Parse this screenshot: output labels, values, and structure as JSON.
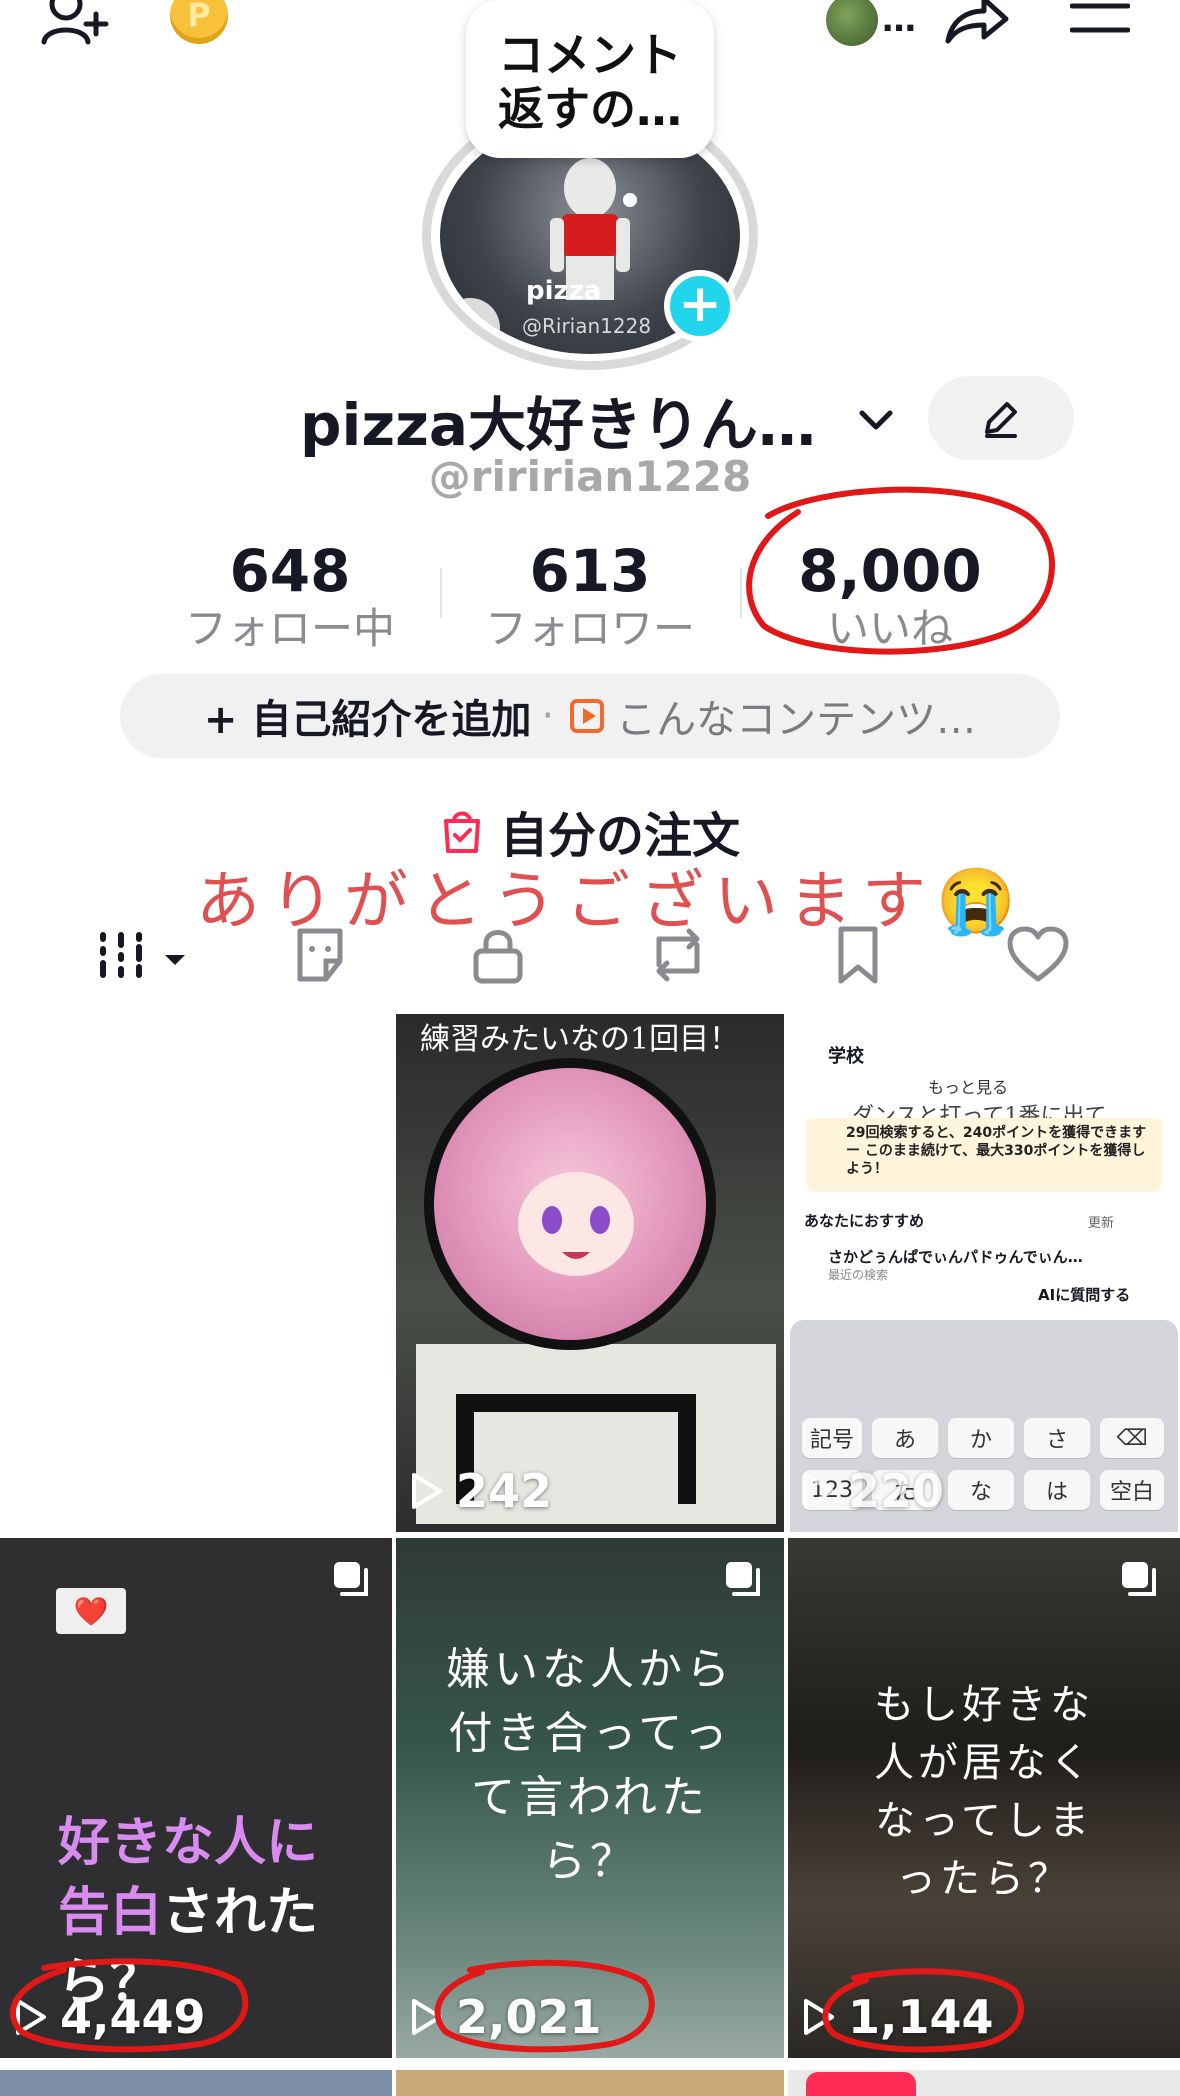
{
  "header": {
    "add_friend_icon": "person-add-icon",
    "coin_label": "P",
    "share_icon": "share-arrow-icon",
    "menu_icon": "hamburger-menu-icon",
    "account_ellipsis": "…"
  },
  "profile": {
    "bubble_text": "コメント\n返すの…",
    "avatar_name": "pizza",
    "avatar_handle": "@Ririan1228",
    "plus_label": "+",
    "display_name": "pizza大好きりん…",
    "username": "@riririan1228",
    "stats": {
      "following_count": "648",
      "following_label": "フォロー中",
      "followers_count": "613",
      "followers_label": "フォロワー",
      "likes_count": "8,000",
      "likes_label": "いいね"
    },
    "bio_add_label": "+ 自己紹介を追加",
    "bio_separator": "·",
    "bio_content_label": "こんなコンテンツ…",
    "orders_label": "自分の注文",
    "overlay_text": "ありがとうございます😭"
  },
  "tabs": [
    "videos-grid",
    "stickers",
    "private",
    "reposts",
    "saved",
    "liked"
  ],
  "grid": {
    "row1": [
      {
        "views": ""
      },
      {
        "views": "242",
        "caption_top": "練習みたいなの1回目！"
      },
      {
        "views": "220",
        "search_title": "学校",
        "search_more": "もっと見る",
        "search_overlay": "ダンスと打って1番に出て",
        "search_promo": "29回検索すると、240ポイントを獲得できます ー このまま続けて、最大330ポイントを獲得しよう！",
        "search_recommend": "あなたにおすすめ",
        "search_refresh": "更新",
        "search_item": "さかどぅんぱでぃんパドゥんでぃん…",
        "search_item_sub": "最近の検索",
        "ai_label": "AIに質問する",
        "kb_row1": [
          "記号",
          "あ",
          "か",
          "さ",
          "⌫"
        ],
        "kb_row2": [
          "123",
          "た",
          "な",
          "は",
          "空白"
        ]
      }
    ],
    "row2": [
      {
        "views": "4,449",
        "caption_pink": "好きな人に\n告白",
        "caption_white": "された\nら？",
        "sticker": "❤️"
      },
      {
        "views": "2,021",
        "caption": "嫌いな人から\n付き合ってっ\nて言われた\nら？"
      },
      {
        "views": "1,144",
        "caption": "もし好きな\n人が居なく\nなってしま\nったら？"
      }
    ]
  },
  "colors": {
    "accent_cyan": "#20d5ec",
    "annotation_red": "#e01818",
    "text_primary": "#161823",
    "text_secondary": "#8a8b91"
  }
}
